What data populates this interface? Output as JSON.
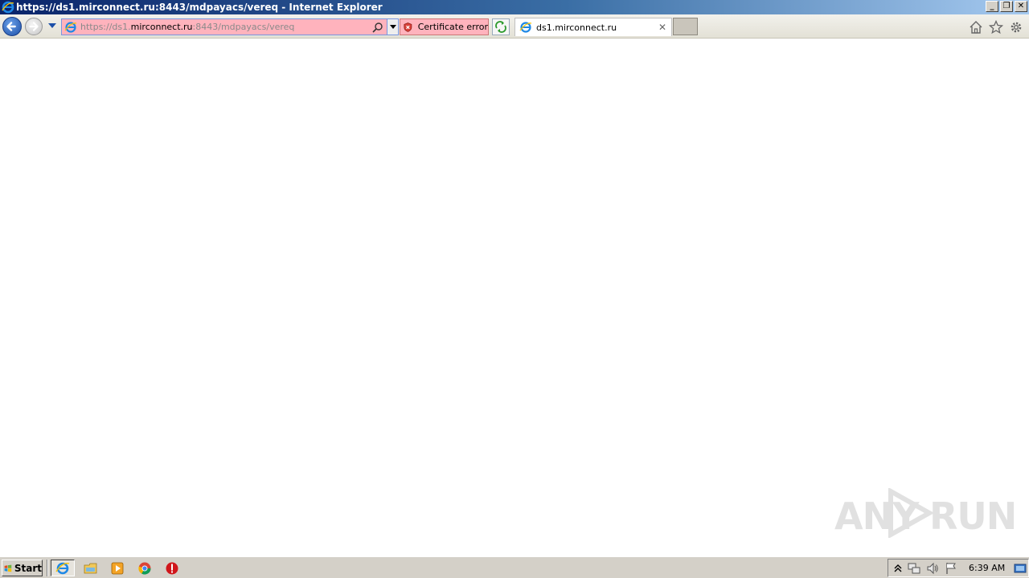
{
  "window": {
    "title": "https://ds1.mirconnect.ru:8443/mdpayacs/vereq - Internet Explorer",
    "controls": [
      "minimize",
      "restore",
      "close"
    ]
  },
  "address_bar": {
    "url_prefix": "https://ds1.",
    "url_host": "mirconnect.ru",
    "url_suffix": ":8443/mdpayacs/vereq",
    "background_color": "#ffb3bd"
  },
  "cert_error": {
    "label": "Certificate error"
  },
  "tab": {
    "label": "ds1.mirconnect.ru"
  },
  "toolbar_icons": [
    "home-icon",
    "favorites-star-icon",
    "tools-gear-icon"
  ],
  "watermark": {
    "text_left": "ANY",
    "text_right": "RUN"
  },
  "taskbar": {
    "start_label": "Start",
    "apps": [
      "internet-explorer-icon",
      "file-explorer-icon",
      "media-player-icon",
      "chrome-icon",
      "stop-sign-icon"
    ],
    "tray_icons": [
      "show-hidden-icons-icon",
      "network-icon",
      "volume-icon",
      "action-center-flag-icon"
    ],
    "clock": "6:39 AM"
  },
  "colors": {
    "titlebar_start": "#0a246a",
    "titlebar_end": "#a6caf0",
    "error_pink": "#ffb3bd",
    "taskbar": "#d4d0c8"
  }
}
